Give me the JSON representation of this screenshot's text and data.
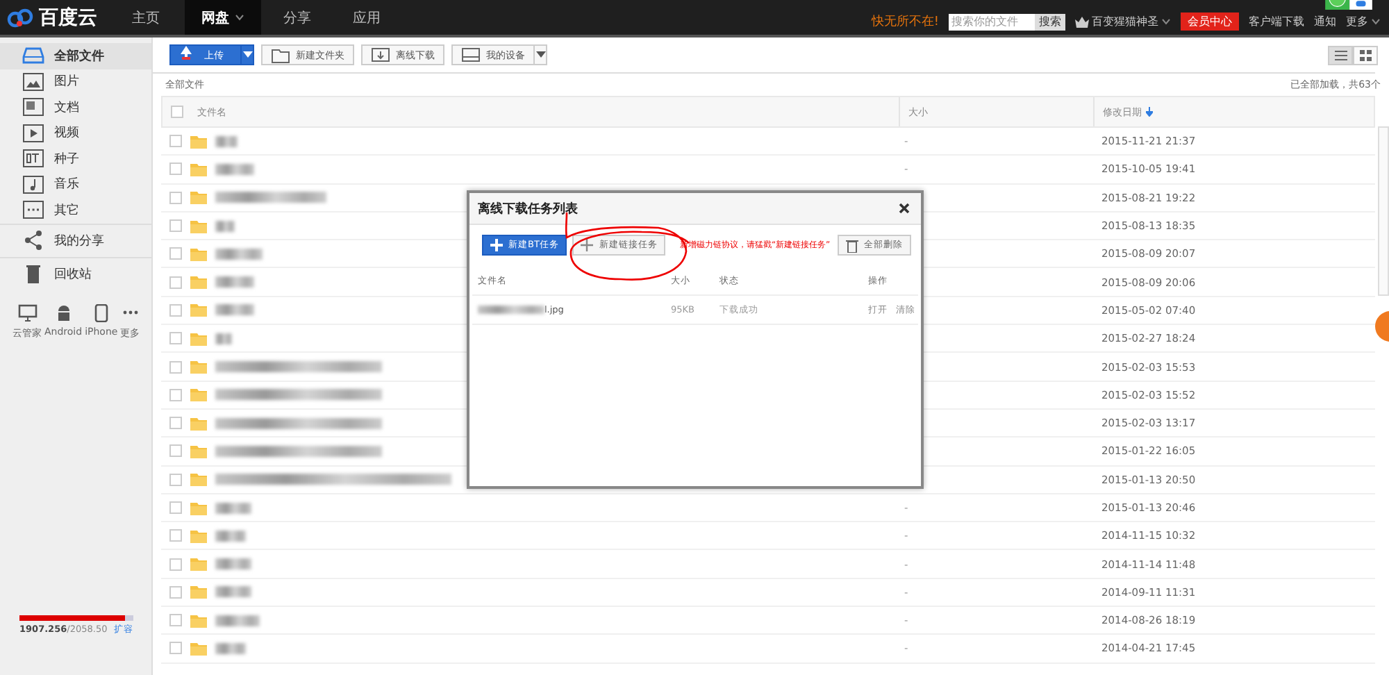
{
  "top_nav": {
    "logo": "百度云",
    "items": [
      {
        "label": "主页",
        "selected": false
      },
      {
        "label": "网盘",
        "selected": true
      },
      {
        "label": "分享",
        "selected": false
      },
      {
        "label": "应用",
        "selected": false
      }
    ],
    "slogan": "快无所不在!",
    "search": {
      "placeholder": "搜索你的文件",
      "button": "搜索"
    },
    "user": "百变猩猫神圣",
    "vip": "会员中心",
    "links": [
      "客户端下载",
      "通知",
      "更多"
    ]
  },
  "sidebar": {
    "items": [
      {
        "label": "全部文件",
        "selected": true
      },
      {
        "label": "图片",
        "selected": false
      },
      {
        "label": "文档",
        "selected": false
      },
      {
        "label": "视频",
        "selected": false
      },
      {
        "label": "种子",
        "selected": false
      },
      {
        "label": "音乐",
        "selected": false
      },
      {
        "label": "其它",
        "selected": false
      }
    ],
    "share": {
      "label": "我的分享",
      "selected": false
    },
    "trash": {
      "label": "回收站",
      "selected": false
    },
    "devices": [
      "云管家",
      "Android",
      "iPhone",
      "更多"
    ],
    "storage": {
      "level": 0.93,
      "text": "**1907.256**/2058.50",
      "expand": "扩容"
    }
  },
  "toolbar": {
    "buttons": [
      {
        "label": "上传",
        "kind": "primary"
      },
      {
        "label": "新建文件夹",
        "kind": "folder"
      },
      {
        "label": "离线下载",
        "kind": "download"
      },
      {
        "label": "我的设备",
        "kind": "device"
      }
    ],
    "views": [
      {
        "kind": "list",
        "selected": true
      },
      {
        "kind": "grid",
        "selected": false
      }
    ]
  },
  "breadcrumb": "全部文件",
  "count": "已全部加载，共63个",
  "table": {
    "columns": [
      "文件名",
      "大小",
      "修改日期"
    ],
    "select_all": {
      "checked": false
    },
    "rows": [
      {
        "checked": false,
        "size": "-",
        "date": "2015-11-21 21:37"
      },
      {
        "checked": false,
        "size": "-",
        "date": "2015-10-05 19:41"
      },
      {
        "checked": false,
        "date": "2015-08-21 19:22"
      },
      {
        "checked": false,
        "date": "2015-08-13 18:35"
      },
      {
        "checked": false,
        "date": "2015-08-09 20:07"
      },
      {
        "checked": false,
        "date": "2015-08-09 20:06"
      },
      {
        "checked": false,
        "date": "2015-05-02 07:40"
      },
      {
        "checked": false,
        "date": "2015-02-27 18:24"
      },
      {
        "checked": false,
        "date": "2015-02-03 15:53"
      },
      {
        "checked": false,
        "date": "2015-02-03 15:52"
      },
      {
        "checked": false,
        "date": "2015-02-03 13:17"
      },
      {
        "checked": false,
        "date": "2015-01-22 16:05"
      },
      {
        "checked": false,
        "date": "2015-01-13 20:50"
      },
      {
        "checked": false,
        "size": "-",
        "date": "2015-01-13 20:46"
      },
      {
        "checked": false,
        "size": "-",
        "date": "2014-11-15 10:32"
      },
      {
        "checked": false,
        "size": "-",
        "date": "2014-11-14 11:48"
      },
      {
        "checked": false,
        "size": "-",
        "date": "2014-09-11 11:31"
      },
      {
        "checked": false,
        "size": "-",
        "date": "2014-08-26 18:19"
      },
      {
        "checked": false,
        "size": "-",
        "date": "2014-04-21 17:45"
      }
    ]
  },
  "dialog": {
    "title": "离线下载任务列表",
    "buttons": [
      {
        "label": "新建BT任务",
        "kind": "primary"
      },
      {
        "label": "新建链接任务",
        "kind": "link"
      }
    ],
    "note": "新增磁力链协议，请猛戳“新建链接任务”",
    "delete_all": "全部删除",
    "columns": [
      "文件名",
      "大小",
      "状态",
      "操作"
    ],
    "tasks": [
      {
        "name": "l.jpg",
        "size": "95KB",
        "status": "下载成功",
        "actions": [
          "打开",
          "清除"
        ]
      }
    ]
  }
}
